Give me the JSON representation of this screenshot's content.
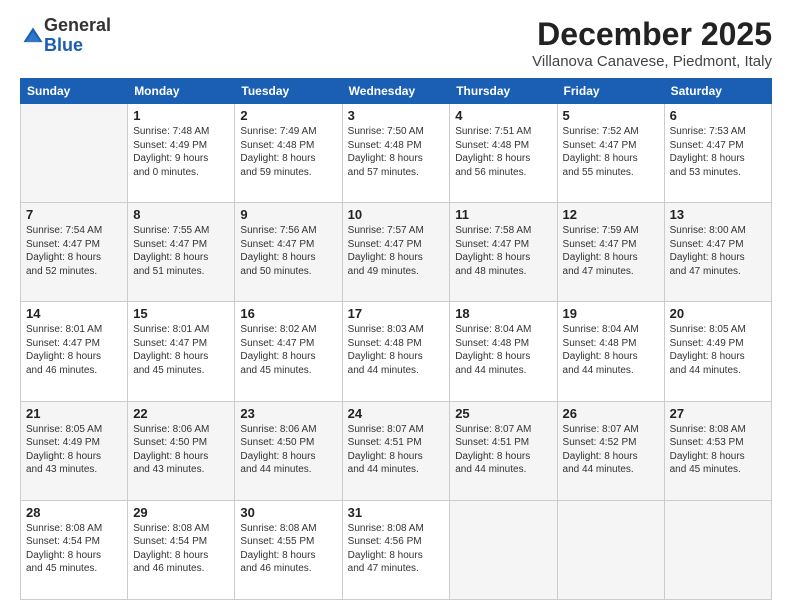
{
  "logo": {
    "general": "General",
    "blue": "Blue"
  },
  "title": "December 2025",
  "subtitle": "Villanova Canavese, Piedmont, Italy",
  "weekdays": [
    "Sunday",
    "Monday",
    "Tuesday",
    "Wednesday",
    "Thursday",
    "Friday",
    "Saturday"
  ],
  "weeks": [
    [
      {
        "day": "",
        "text": ""
      },
      {
        "day": "1",
        "text": "Sunrise: 7:48 AM\nSunset: 4:49 PM\nDaylight: 9 hours\nand 0 minutes."
      },
      {
        "day": "2",
        "text": "Sunrise: 7:49 AM\nSunset: 4:48 PM\nDaylight: 8 hours\nand 59 minutes."
      },
      {
        "day": "3",
        "text": "Sunrise: 7:50 AM\nSunset: 4:48 PM\nDaylight: 8 hours\nand 57 minutes."
      },
      {
        "day": "4",
        "text": "Sunrise: 7:51 AM\nSunset: 4:48 PM\nDaylight: 8 hours\nand 56 minutes."
      },
      {
        "day": "5",
        "text": "Sunrise: 7:52 AM\nSunset: 4:47 PM\nDaylight: 8 hours\nand 55 minutes."
      },
      {
        "day": "6",
        "text": "Sunrise: 7:53 AM\nSunset: 4:47 PM\nDaylight: 8 hours\nand 53 minutes."
      }
    ],
    [
      {
        "day": "7",
        "text": "Sunrise: 7:54 AM\nSunset: 4:47 PM\nDaylight: 8 hours\nand 52 minutes."
      },
      {
        "day": "8",
        "text": "Sunrise: 7:55 AM\nSunset: 4:47 PM\nDaylight: 8 hours\nand 51 minutes."
      },
      {
        "day": "9",
        "text": "Sunrise: 7:56 AM\nSunset: 4:47 PM\nDaylight: 8 hours\nand 50 minutes."
      },
      {
        "day": "10",
        "text": "Sunrise: 7:57 AM\nSunset: 4:47 PM\nDaylight: 8 hours\nand 49 minutes."
      },
      {
        "day": "11",
        "text": "Sunrise: 7:58 AM\nSunset: 4:47 PM\nDaylight: 8 hours\nand 48 minutes."
      },
      {
        "day": "12",
        "text": "Sunrise: 7:59 AM\nSunset: 4:47 PM\nDaylight: 8 hours\nand 47 minutes."
      },
      {
        "day": "13",
        "text": "Sunrise: 8:00 AM\nSunset: 4:47 PM\nDaylight: 8 hours\nand 47 minutes."
      }
    ],
    [
      {
        "day": "14",
        "text": "Sunrise: 8:01 AM\nSunset: 4:47 PM\nDaylight: 8 hours\nand 46 minutes."
      },
      {
        "day": "15",
        "text": "Sunrise: 8:01 AM\nSunset: 4:47 PM\nDaylight: 8 hours\nand 45 minutes."
      },
      {
        "day": "16",
        "text": "Sunrise: 8:02 AM\nSunset: 4:47 PM\nDaylight: 8 hours\nand 45 minutes."
      },
      {
        "day": "17",
        "text": "Sunrise: 8:03 AM\nSunset: 4:48 PM\nDaylight: 8 hours\nand 44 minutes."
      },
      {
        "day": "18",
        "text": "Sunrise: 8:04 AM\nSunset: 4:48 PM\nDaylight: 8 hours\nand 44 minutes."
      },
      {
        "day": "19",
        "text": "Sunrise: 8:04 AM\nSunset: 4:48 PM\nDaylight: 8 hours\nand 44 minutes."
      },
      {
        "day": "20",
        "text": "Sunrise: 8:05 AM\nSunset: 4:49 PM\nDaylight: 8 hours\nand 44 minutes."
      }
    ],
    [
      {
        "day": "21",
        "text": "Sunrise: 8:05 AM\nSunset: 4:49 PM\nDaylight: 8 hours\nand 43 minutes."
      },
      {
        "day": "22",
        "text": "Sunrise: 8:06 AM\nSunset: 4:50 PM\nDaylight: 8 hours\nand 43 minutes."
      },
      {
        "day": "23",
        "text": "Sunrise: 8:06 AM\nSunset: 4:50 PM\nDaylight: 8 hours\nand 44 minutes."
      },
      {
        "day": "24",
        "text": "Sunrise: 8:07 AM\nSunset: 4:51 PM\nDaylight: 8 hours\nand 44 minutes."
      },
      {
        "day": "25",
        "text": "Sunrise: 8:07 AM\nSunset: 4:51 PM\nDaylight: 8 hours\nand 44 minutes."
      },
      {
        "day": "26",
        "text": "Sunrise: 8:07 AM\nSunset: 4:52 PM\nDaylight: 8 hours\nand 44 minutes."
      },
      {
        "day": "27",
        "text": "Sunrise: 8:08 AM\nSunset: 4:53 PM\nDaylight: 8 hours\nand 45 minutes."
      }
    ],
    [
      {
        "day": "28",
        "text": "Sunrise: 8:08 AM\nSunset: 4:54 PM\nDaylight: 8 hours\nand 45 minutes."
      },
      {
        "day": "29",
        "text": "Sunrise: 8:08 AM\nSunset: 4:54 PM\nDaylight: 8 hours\nand 46 minutes."
      },
      {
        "day": "30",
        "text": "Sunrise: 8:08 AM\nSunset: 4:55 PM\nDaylight: 8 hours\nand 46 minutes."
      },
      {
        "day": "31",
        "text": "Sunrise: 8:08 AM\nSunset: 4:56 PM\nDaylight: 8 hours\nand 47 minutes."
      },
      {
        "day": "",
        "text": ""
      },
      {
        "day": "",
        "text": ""
      },
      {
        "day": "",
        "text": ""
      }
    ]
  ]
}
